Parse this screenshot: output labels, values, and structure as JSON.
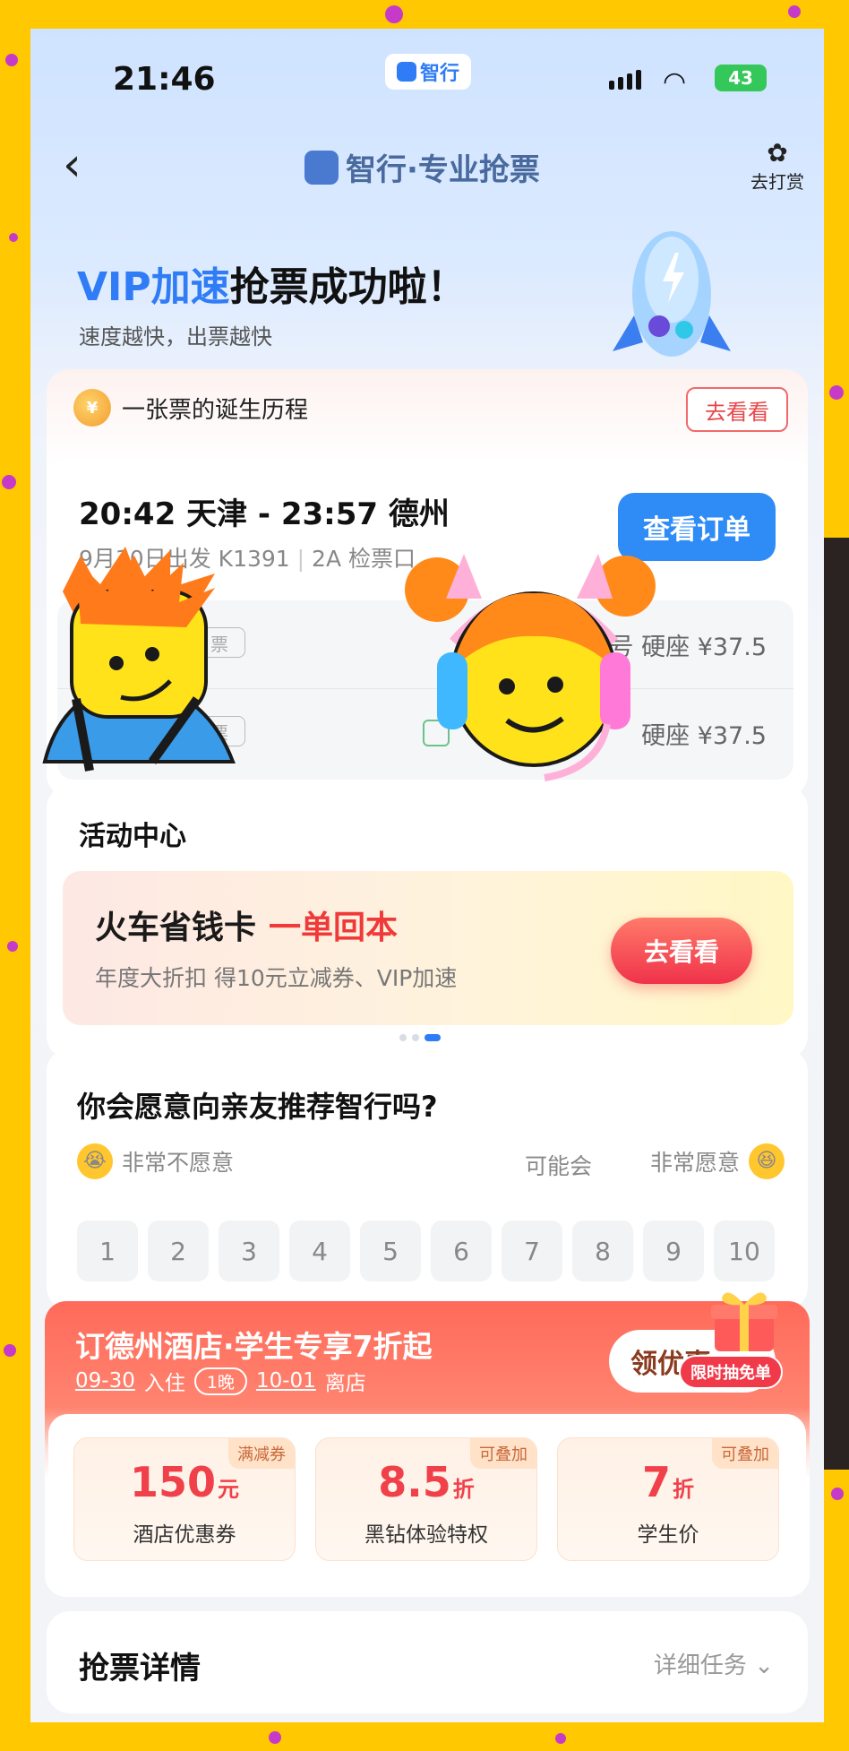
{
  "status_bar": {
    "time": "21:46",
    "app_badge": "智行",
    "battery": "43"
  },
  "nav": {
    "title": "智行·专业抢票",
    "tip_label": "去打赏"
  },
  "hero": {
    "title_vip": "VIP加速",
    "title_rest": "抢票成功啦！",
    "subtitle": "速度越快，出票越快"
  },
  "ticket": {
    "birth_label": "一张票的诞生历程",
    "birth_button": "去看看",
    "route": "20:42 天津 - 23:57 德州",
    "date": "9月30日出发",
    "train": "K1391",
    "gate": "2A 检票口",
    "order_button": "查看订单",
    "passengers": [
      {
        "tag": "票",
        "seat": "号 硬座 ¥37.5"
      },
      {
        "tag": "票",
        "seat": "硬座 ¥37.5"
      }
    ]
  },
  "activity": {
    "title": "活动中心",
    "promo_title": "火车省钱卡",
    "promo_highlight": "一单回本",
    "promo_sub": "年度大折扣 得10元立减券、VIP加速",
    "promo_button": "去看看"
  },
  "nps": {
    "question": "你会愿意向亲友推荐智行吗?",
    "low_label": "非常不愿意",
    "mid_label": "可能会",
    "high_label": "非常愿意",
    "scale": [
      "1",
      "2",
      "3",
      "4",
      "5",
      "6",
      "7",
      "8",
      "9",
      "10"
    ]
  },
  "hotel": {
    "title": "订德州酒店·学生专享7折起",
    "checkin_date": "09-30",
    "checkin_label": "入住",
    "nights": "1晚",
    "checkout_date": "10-01",
    "checkout_label": "离店",
    "button": "领优惠",
    "limit_badge": "限时抽免单",
    "coupons": [
      {
        "tag": "满减券",
        "value": "150",
        "unit": "元",
        "label": "酒店优惠券"
      },
      {
        "tag": "可叠加",
        "value": "8.5",
        "unit": "折",
        "label": "黑钻体验特权"
      },
      {
        "tag": "可叠加",
        "value": "7",
        "unit": "折",
        "label": "学生价"
      }
    ]
  },
  "detail": {
    "title": "抢票详情",
    "link": "详细任务"
  },
  "colors": {
    "accent": "#2f7cf6",
    "red": "#f03a3a",
    "frame": "#ffc800"
  }
}
